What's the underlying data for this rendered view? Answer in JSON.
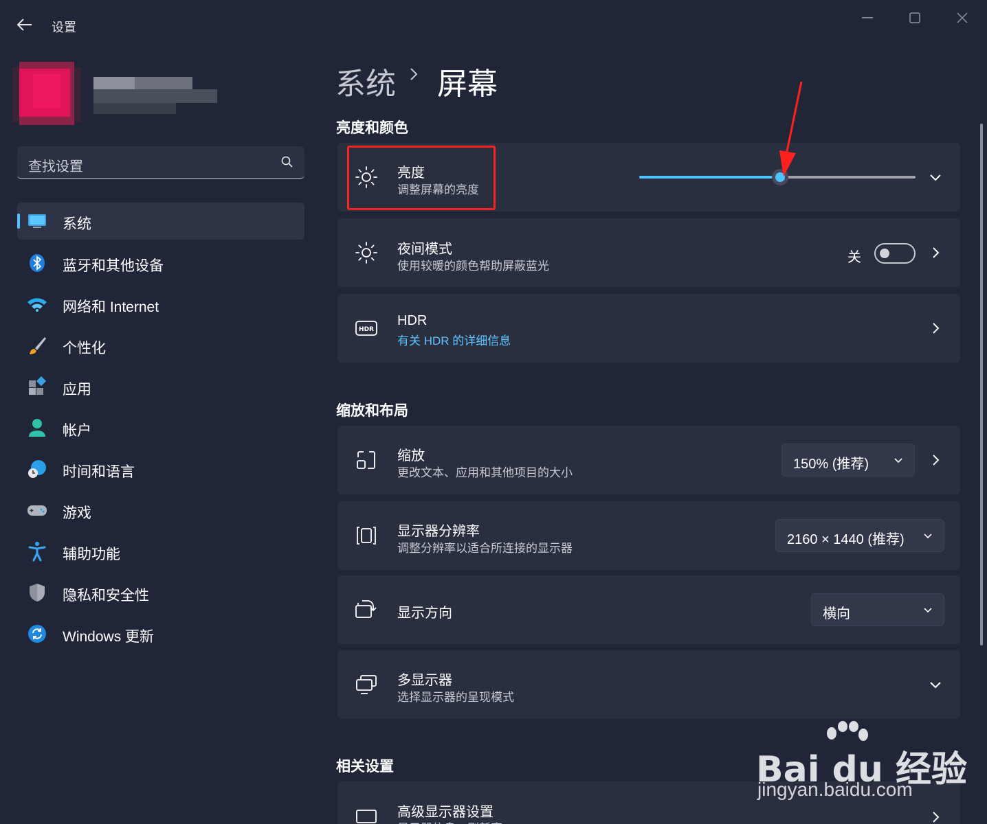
{
  "titlebar": {
    "app_title": "设置"
  },
  "sidebar": {
    "search_placeholder": "查找设置",
    "items": [
      {
        "label": "系统",
        "icon": "monitor-icon",
        "active": true
      },
      {
        "label": "蓝牙和其他设备",
        "icon": "bluetooth-icon"
      },
      {
        "label": "网络和 Internet",
        "icon": "wifi-icon"
      },
      {
        "label": "个性化",
        "icon": "brush-icon"
      },
      {
        "label": "应用",
        "icon": "apps-icon"
      },
      {
        "label": "帐户",
        "icon": "person-icon"
      },
      {
        "label": "时间和语言",
        "icon": "globe-clock-icon"
      },
      {
        "label": "游戏",
        "icon": "gamepad-icon"
      },
      {
        "label": "辅助功能",
        "icon": "accessibility-icon"
      },
      {
        "label": "隐私和安全性",
        "icon": "shield-icon"
      },
      {
        "label": "Windows 更新",
        "icon": "update-icon"
      }
    ]
  },
  "breadcrumb": {
    "parent": "系统",
    "current": "屏幕"
  },
  "sections": {
    "brightness_color": "亮度和颜色",
    "scale_layout": "缩放和布局",
    "related": "相关设置"
  },
  "brightness": {
    "title": "亮度",
    "subtitle": "调整屏幕的亮度",
    "level": 0.51
  },
  "night_light": {
    "title": "夜间模式",
    "subtitle": "使用较暖的颜色帮助屏蔽蓝光",
    "state_label": "关"
  },
  "hdr": {
    "title": "HDR",
    "link": "有关 HDR 的详细信息"
  },
  "scale": {
    "title": "缩放",
    "subtitle": "更改文本、应用和其他项目的大小",
    "value": "150% (推荐)"
  },
  "resolution": {
    "title": "显示器分辨率",
    "subtitle": "调整分辨率以适合所连接的显示器",
    "value": "2160 × 1440 (推荐)"
  },
  "orientation": {
    "title": "显示方向",
    "value": "横向"
  },
  "multi_display": {
    "title": "多显示器",
    "subtitle": "选择显示器的呈现模式"
  },
  "advanced_display": {
    "title": "高级显示器设置",
    "subtitle": "显示器信息，刷新率"
  },
  "watermark": {
    "brand": "Bai du 经验",
    "url": "jingyan.baidu.com"
  },
  "colors": {
    "accent": "#4cc2ff",
    "background": "#202638",
    "card": "#2a2f40",
    "annotation": "#ff2020"
  }
}
